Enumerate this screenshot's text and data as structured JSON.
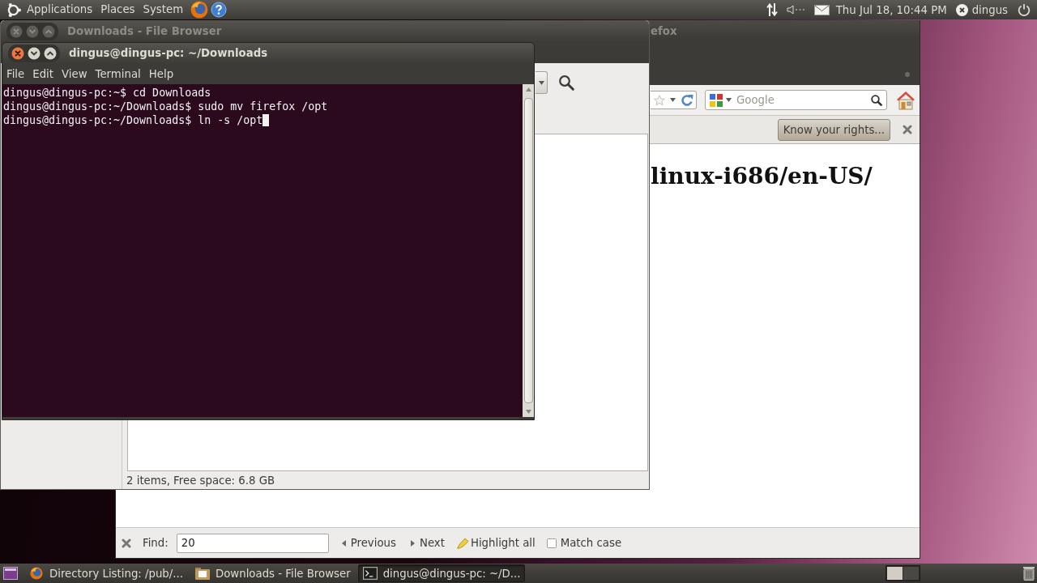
{
  "top_panel": {
    "menus": [
      "Applications",
      "Places",
      "System"
    ],
    "clock": "Thu Jul 18, 10:44 PM",
    "user": "dingus"
  },
  "file_browser_window": {
    "title": "Downloads - File Browser",
    "focused": false,
    "status": "2 items, Free space: 6.8 GB"
  },
  "browser_window": {
    "title": "efox",
    "focused": false,
    "search": {
      "placeholder": "Google"
    },
    "notification": {
      "button": "Know your rights..."
    },
    "page_heading": "linux-i686/en-US/",
    "find_bar": {
      "label": "Find:",
      "value": "20",
      "previous": "Previous",
      "next": "Next",
      "highlight_all": "Highlight all",
      "match_case": {
        "label": "Match case",
        "checked": false
      }
    }
  },
  "terminal_window": {
    "title": "dingus@dingus-pc: ~/Downloads",
    "focused": true,
    "menu": [
      "File",
      "Edit",
      "View",
      "Terminal",
      "Help"
    ],
    "lines": [
      "dingus@dingus-pc:~$ cd Downloads",
      "dingus@dingus-pc:~/Downloads$ sudo mv firefox /opt",
      "dingus@dingus-pc:~/Downloads$ ln -s /opt"
    ]
  },
  "taskbar": {
    "tasks": [
      {
        "kind": "browser",
        "label": "Directory Listing: /pub/...",
        "selected": false
      },
      {
        "kind": "file_browser",
        "label": "Downloads - File Browser",
        "selected": false
      },
      {
        "kind": "terminal",
        "label": "dingus@dingus-pc: ~/D...",
        "selected": true
      }
    ],
    "workspaces": [
      {
        "selected": true
      },
      {
        "selected": false
      }
    ]
  }
}
